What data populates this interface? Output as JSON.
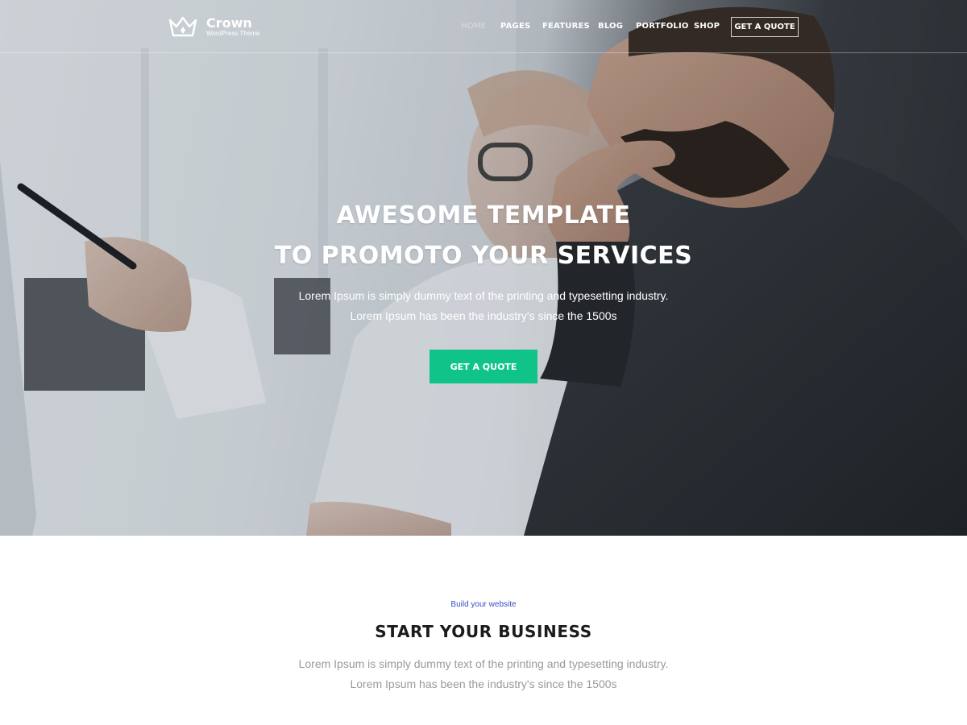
{
  "brand": {
    "name": "Crown",
    "tagline": "WordPress Theme",
    "logo_icon": "crown-icon"
  },
  "nav": {
    "items": [
      {
        "label": "HOME",
        "active": true
      },
      {
        "label": "PAGES",
        "active": false
      },
      {
        "label": "FEATURES",
        "active": false
      },
      {
        "label": "BLOG",
        "active": false
      },
      {
        "label": "PORTFOLIO",
        "active": false
      },
      {
        "label": "SHOP",
        "active": false
      }
    ],
    "cta_label": "GET A QUOTE"
  },
  "hero": {
    "title_line1": "AWESOME TEMPLATE",
    "title_line2": "TO PROMOTO YOUR SERVICES",
    "subtitle_line1": "Lorem Ipsum is simply dummy text of the printing and typesetting industry.",
    "subtitle_line2": "Lorem Ipsum has been the industry's since the 1500s",
    "cta_label": "GET A QUOTE",
    "cta_color": "#10c489"
  },
  "section": {
    "kicker": "Build your website",
    "title": "START YOUR BUSINESS",
    "text_line1": "Lorem Ipsum is simply dummy text of the printing and typesetting industry.",
    "text_line2": "Lorem Ipsum has been the industry's since the 1500s"
  },
  "colors": {
    "accent": "#10c489",
    "kicker": "#3a4fc4",
    "heading": "#1b1b1b",
    "body_text": "#9a9a9a"
  }
}
